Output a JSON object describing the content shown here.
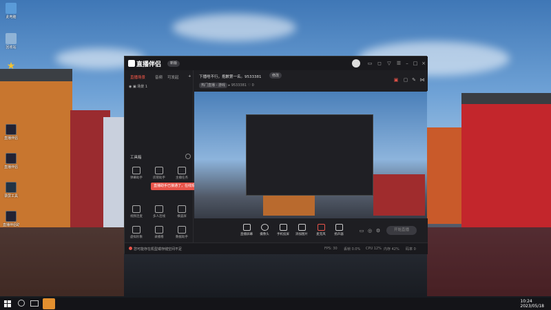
{
  "desktop": {
    "icons": [
      {
        "name": "pc-icon",
        "label": "此电脑"
      },
      {
        "name": "recycle-bin-icon",
        "label": "回收站"
      },
      {
        "name": "star-shortcut-icon",
        "label": ""
      },
      {
        "name": "app-shortcut-1-icon",
        "label": "直播伴侣"
      },
      {
        "name": "app-shortcut-2-icon",
        "label": "直播伴侣"
      },
      {
        "name": "app-shortcut-3-icon",
        "label": "录屏工具"
      },
      {
        "name": "app-shortcut-4-icon",
        "label": "直播伴侣助手"
      }
    ]
  },
  "app": {
    "title": "直播伴侣",
    "version": "新版",
    "sidebar": {
      "tabs": [
        "直播场景",
        "音频",
        "可发起"
      ],
      "scene_label": "场景 1",
      "tools_title": "工具箱",
      "tools": [
        {
          "label": "弹幕助手",
          "icon": "barrage-icon"
        },
        {
          "label": "房管助手",
          "icon": "moderator-icon"
        },
        {
          "label": "主播任务",
          "icon": "task-icon"
        },
        {
          "label": "视频连麦",
          "icon": "video-link-icon"
        },
        {
          "label": "多人连线",
          "icon": "multi-link-icon"
        },
        {
          "label": "横竖屏",
          "icon": "orientation-icon"
        },
        {
          "label": "虚拟形象",
          "icon": "avatar-icon"
        },
        {
          "label": "录播看",
          "icon": "recording-icon"
        },
        {
          "label": "数据助手",
          "icon": "data-icon"
        }
      ],
      "toast": "直播助手已接通了，在线观众了~"
    },
    "info": {
      "live_title": "下播啥不行，抱歉第一名。9533381",
      "modify_label": "修改",
      "tag": "热门直播 - 游戏",
      "room_id": "9533381",
      "likes": "0"
    },
    "bottom_toolbar": [
      {
        "label": "直播屏幕",
        "icon": "screen-icon"
      },
      {
        "label": "摄像头",
        "icon": "camera-icon"
      },
      {
        "label": "手机投屏",
        "icon": "phone-cast-icon"
      },
      {
        "label": "添加图片",
        "icon": "image-icon"
      },
      {
        "label": "麦克风",
        "icon": "mic-icon"
      },
      {
        "label": "扬声器",
        "icon": "speaker-icon"
      }
    ],
    "start_live_label": "开始直播",
    "status": {
      "message": "您可能存在机型或存储空间不足",
      "items": [
        "FPS: 30",
        "丢帧 0.0%",
        "CPU 12%",
        "内存 42%",
        "码率 0"
      ]
    }
  },
  "taskbar": {
    "time": "10:24",
    "date": "2023/05/18"
  }
}
